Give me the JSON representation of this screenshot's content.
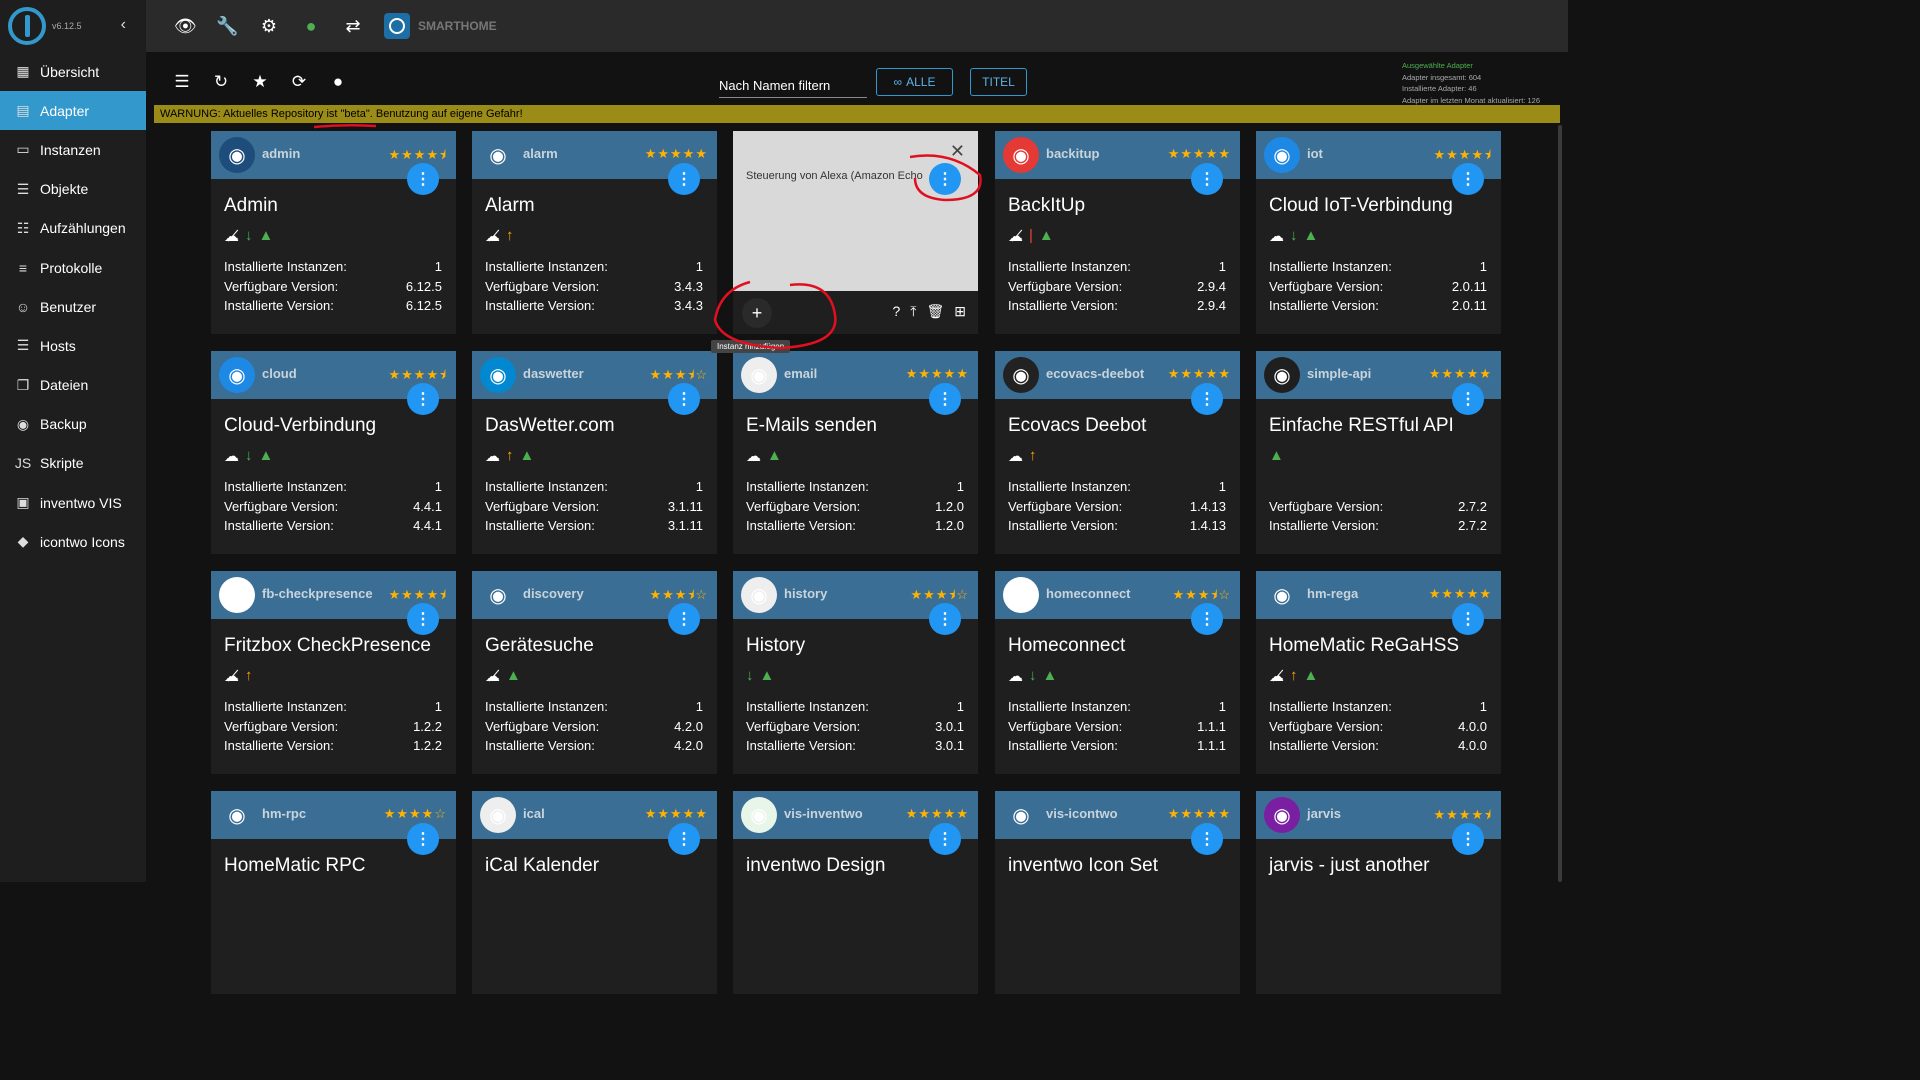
{
  "sidebar": {
    "version": "v6.12.5",
    "items": [
      {
        "label": "Übersicht",
        "icon": "grid-icon",
        "glyph": "▦"
      },
      {
        "label": "Adapter",
        "icon": "adapter-icon",
        "glyph": "▤"
      },
      {
        "label": "Instanzen",
        "icon": "instances-icon",
        "glyph": "▭"
      },
      {
        "label": "Objekte",
        "icon": "objects-icon",
        "glyph": "☰"
      },
      {
        "label": "Aufzählungen",
        "icon": "enums-icon",
        "glyph": "☷"
      },
      {
        "label": "Protokolle",
        "icon": "logs-icon",
        "glyph": "≡"
      },
      {
        "label": "Benutzer",
        "icon": "user-icon",
        "glyph": "☺"
      },
      {
        "label": "Hosts",
        "icon": "hosts-icon",
        "glyph": "☰"
      },
      {
        "label": "Dateien",
        "icon": "files-icon",
        "glyph": "❐"
      },
      {
        "label": "Backup",
        "icon": "backup-icon",
        "glyph": "◉"
      },
      {
        "label": "Skripte",
        "icon": "scripts-icon",
        "glyph": "JS"
      },
      {
        "label": "inventwo VIS",
        "icon": "vis-icon",
        "glyph": "▣"
      },
      {
        "label": "icontwo Icons",
        "icon": "icons-icon",
        "glyph": "◆"
      }
    ],
    "active_index": 1
  },
  "topbar": {
    "app_name": "SMARTHOME"
  },
  "toolbar": {
    "filter_label": "Nach Namen filtern",
    "btn_all": "ALLE",
    "btn_title": "TITEL"
  },
  "stats": {
    "heading": "Ausgewählte Adapter",
    "total": "Adapter insgesamt: 604",
    "installed": "Installierte Adapter: 46",
    "updated": "Adapter im letzten Monat aktualisiert: 126"
  },
  "warning": "WARNUNG: Aktuelles Repository ist \"beta\". Benutzung auf eigene Gefahr!",
  "labels": {
    "instances": "Installierte Instanzen:",
    "available": "Verfügbare Version:",
    "installed": "Installierte Version:"
  },
  "popup": {
    "description": "Steuerung von Alexa (Amazon Echo",
    "tooltip": "Instanz hinzufügen"
  },
  "cards": [
    {
      "short": "admin",
      "title": "Admin",
      "stars": "★★★★⯨",
      "badges": [
        "nocloud",
        "down",
        "tri"
      ],
      "instances": "1",
      "available": "6.12.5",
      "installed": "6.12.5",
      "icon": "admin-icon",
      "icon_color": "#1e4d7b"
    },
    {
      "short": "alarm",
      "title": "Alarm",
      "stars": "★★★★★",
      "badges": [
        "nocloud",
        "up"
      ],
      "instances": "1",
      "available": "3.4.3",
      "installed": "3.4.3",
      "icon": "alarm-icon",
      "icon_color": "#3b6e94"
    },
    {
      "short": "backitup",
      "title": "BackItUp",
      "stars": "★★★★★",
      "badges": [
        "nocloud",
        "red",
        "tri"
      ],
      "instances": "1",
      "available": "2.9.4",
      "installed": "2.9.4",
      "icon": "backitup-icon",
      "icon_color": "#e53935"
    },
    {
      "short": "iot",
      "title": "Cloud IoT-Verbindung",
      "stars": "★★★★⯨",
      "badges": [
        "cloud",
        "down",
        "tri"
      ],
      "instances": "1",
      "available": "2.0.11",
      "installed": "2.0.11",
      "icon": "iot-icon",
      "icon_color": "#1e88e5"
    },
    {
      "short": "cloud",
      "title": "Cloud-Verbindung",
      "stars": "★★★★⯨",
      "badges": [
        "cloud",
        "down",
        "tri"
      ],
      "instances": "1",
      "available": "4.4.1",
      "installed": "4.4.1",
      "icon": "cloud-icon",
      "icon_color": "#1e88e5"
    },
    {
      "short": "daswetter",
      "title": "DasWetter.com",
      "stars": "★★★⯨☆",
      "badges": [
        "cloud",
        "up",
        "tri"
      ],
      "instances": "1",
      "available": "3.1.11",
      "installed": "3.1.11",
      "icon": "daswetter-icon",
      "icon_color": "#0288d1"
    },
    {
      "short": "email",
      "title": "E-Mails senden",
      "stars": "★★★★★",
      "badges": [
        "cloud",
        "tri"
      ],
      "instances": "1",
      "available": "1.2.0",
      "installed": "1.2.0",
      "icon": "email-icon",
      "icon_color": "#eeeeee"
    },
    {
      "short": "ecovacs-deebot",
      "title": "Ecovacs Deebot",
      "stars": "★★★★★",
      "badges": [
        "cloud",
        "up"
      ],
      "instances": "1",
      "available": "1.4.13",
      "installed": "1.4.13",
      "icon": "deebot-icon",
      "icon_color": "#222222"
    },
    {
      "short": "simple-api",
      "title": "Einfache RESTful API",
      "stars": "★★★★★",
      "badges": [
        "tri"
      ],
      "instances": "",
      "available": "2.7.2",
      "installed": "2.7.2",
      "icon": "simple-api-icon",
      "icon_color": "#1f1f1f"
    },
    {
      "short": "fb-checkpresence",
      "title": "Fritzbox CheckPresence",
      "stars": "★★★★⯨",
      "badges": [
        "nocloud",
        "up"
      ],
      "instances": "1",
      "available": "1.2.2",
      "installed": "1.2.2",
      "icon": "fritzbox-icon",
      "icon_color": "#ffffff"
    },
    {
      "short": "discovery",
      "title": "Gerätesuche",
      "stars": "★★★⯨☆",
      "badges": [
        "nocloud",
        "tri"
      ],
      "instances": "1",
      "available": "4.2.0",
      "installed": "4.2.0",
      "icon": "discovery-icon",
      "icon_color": "#3b6e94"
    },
    {
      "short": "history",
      "title": "History",
      "stars": "★★★⯨☆",
      "badges": [
        "down",
        "tri"
      ],
      "instances": "1",
      "available": "3.0.1",
      "installed": "3.0.1",
      "icon": "history-icon",
      "icon_color": "#eeeeee"
    },
    {
      "short": "homeconnect",
      "title": "Homeconnect",
      "stars": "★★★⯨☆",
      "badges": [
        "cloud",
        "down",
        "tri"
      ],
      "instances": "1",
      "available": "1.1.1",
      "installed": "1.1.1",
      "icon": "homeconnect-icon",
      "icon_color": "#ffffff"
    },
    {
      "short": "hm-rega",
      "title": "HomeMatic ReGaHSS",
      "stars": "★★★★★",
      "badges": [
        "nocloud",
        "up",
        "tri"
      ],
      "instances": "1",
      "available": "4.0.0",
      "installed": "4.0.0",
      "icon": "hm-rega-icon",
      "icon_color": "#3b6e94"
    },
    {
      "short": "hm-rpc",
      "title": "HomeMatic RPC",
      "stars": "★★★★☆",
      "badges": [],
      "instances": "",
      "available": "",
      "installed": "",
      "icon": "hm-rpc-icon",
      "icon_color": "#3b6e94"
    },
    {
      "short": "ical",
      "title": "iCal Kalender",
      "stars": "★★★★★",
      "badges": [],
      "instances": "",
      "available": "",
      "installed": "",
      "icon": "ical-icon",
      "icon_color": "#eeeeee"
    },
    {
      "short": "vis-inventwo",
      "title": "inventwo Design",
      "stars": "★★★★★",
      "badges": [],
      "instances": "",
      "available": "",
      "installed": "",
      "icon": "vis-inventwo-icon",
      "icon_color": "#e8f5e9"
    },
    {
      "short": "vis-icontwo",
      "title": "inventwo Icon Set",
      "stars": "★★★★★",
      "badges": [],
      "instances": "",
      "available": "",
      "installed": "",
      "icon": "vis-icontwo-icon",
      "icon_color": "#3b6e94"
    },
    {
      "short": "jarvis",
      "title": "jarvis - just another",
      "stars": "★★★★⯨",
      "badges": [],
      "instances": "",
      "available": "",
      "installed": "",
      "icon": "jarvis-icon",
      "icon_color": "#7b1fa2"
    }
  ]
}
